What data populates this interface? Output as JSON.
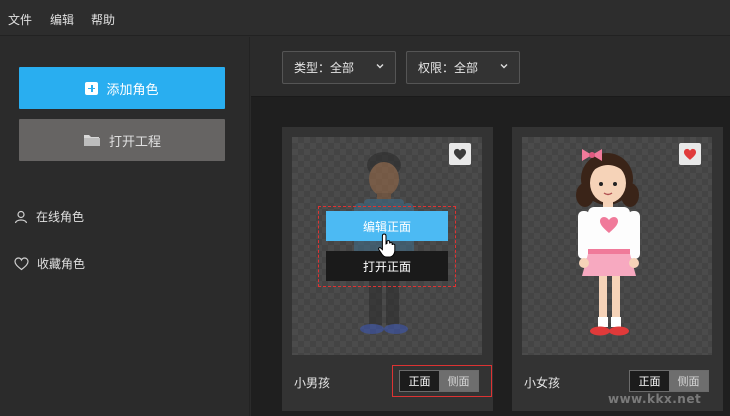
{
  "menubar": {
    "items": [
      "文件",
      "编辑",
      "帮助"
    ]
  },
  "sidebar": {
    "add_label": "添加角色",
    "open_label": "打开工程",
    "links": [
      "在线角色",
      "收藏角色"
    ]
  },
  "filters": {
    "type_label": "类型：全部",
    "perm_label": "权限：全部"
  },
  "cards": [
    {
      "name": "小男孩",
      "favorited": false,
      "overlay": {
        "edit_label": "编辑正面",
        "open_label": "打开正面"
      },
      "view_front": "正面",
      "view_side": "侧面",
      "active_view": "正面"
    },
    {
      "name": "小女孩",
      "favorited": true,
      "view_front": "正面",
      "view_side": "侧面",
      "active_view": "正面"
    }
  ],
  "colors": {
    "accent": "#29aef0",
    "heart_red": "#e03a3a",
    "highlight_red": "#dd3333"
  },
  "watermark": "www.kkx.net"
}
